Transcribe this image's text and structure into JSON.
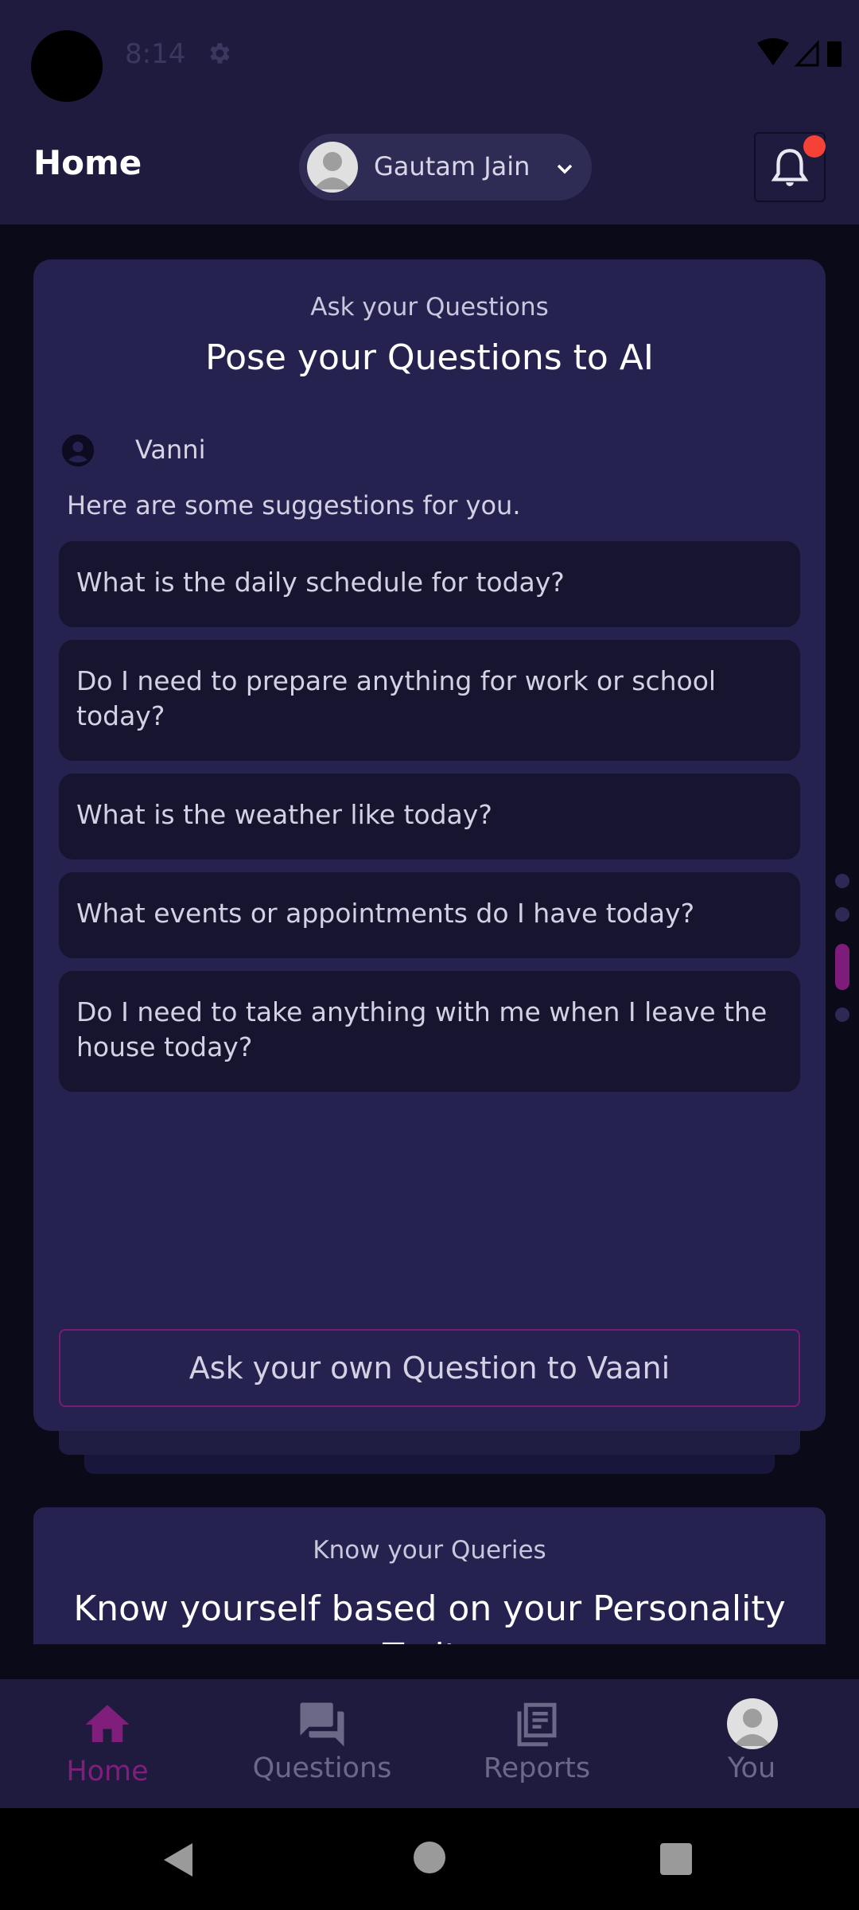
{
  "status_bar": {
    "time": "8:14"
  },
  "header": {
    "title": "Home",
    "profile_name": "Gautam Jain"
  },
  "ask_card": {
    "subtitle": "Ask your Questions",
    "title": "Pose your Questions to AI",
    "assistant_name": "Vanni",
    "hint": "Here are some suggestions for you.",
    "suggestions": [
      "What is the daily schedule for today?",
      "Do I need to prepare anything for work or school today?",
      "What is the weather like today?",
      "What events or appointments do I have today?",
      "Do I need to take anything with me when I leave the house today?"
    ],
    "ask_button_label": "Ask your own Question to Vaani"
  },
  "know_card": {
    "subtitle": "Know your Queries",
    "title": "Know yourself based on your Personality Traits"
  },
  "bottom_nav": {
    "items": [
      {
        "label": "Home",
        "icon": "home-icon",
        "active": true
      },
      {
        "label": "Questions",
        "icon": "chat-icon",
        "active": false
      },
      {
        "label": "Reports",
        "icon": "reports-icon",
        "active": false
      },
      {
        "label": "You",
        "icon": "avatar",
        "active": false
      }
    ]
  },
  "colors": {
    "accent": "#7f1f7b",
    "header_bg": "#1e1b3f",
    "card_bg": "#252250",
    "notification_dot": "#f44336"
  }
}
